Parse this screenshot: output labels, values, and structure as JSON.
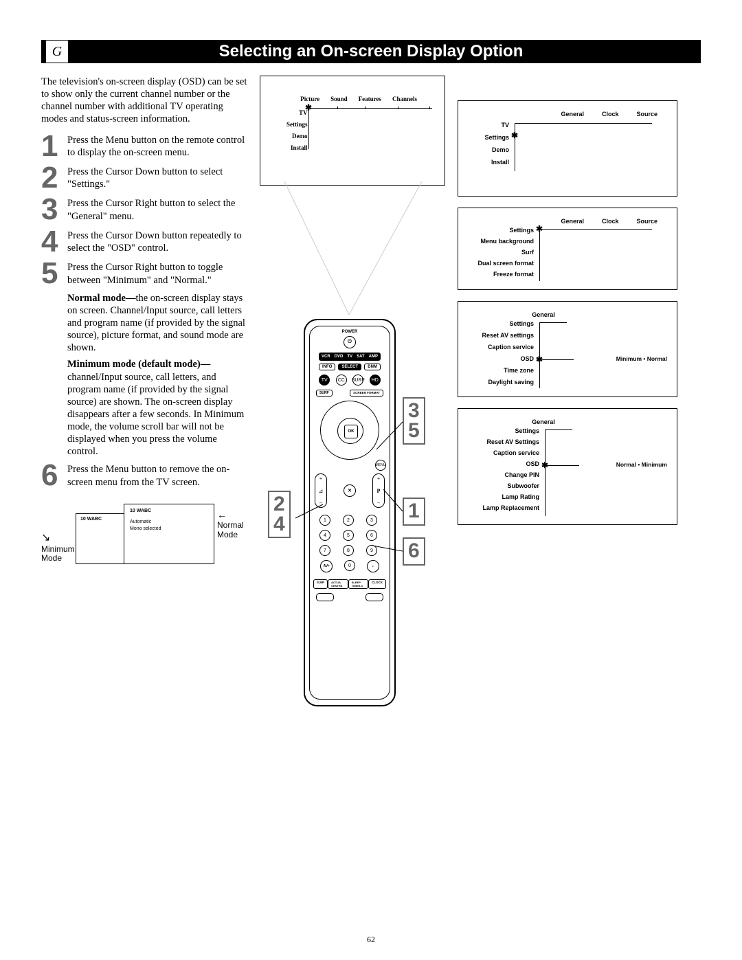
{
  "header": {
    "letter": "G",
    "title": "Selecting an On-screen Display Option"
  },
  "intro": "The television's on-screen display (OSD) can be set to show only the current channel number or the channel number with additional TV operating modes and status-screen information.",
  "steps": [
    {
      "n": "1",
      "text": "Press the Menu button on the remote control to display the on-screen menu."
    },
    {
      "n": "2",
      "text": "Press the Cursor Down button to select \"Settings.\""
    },
    {
      "n": "3",
      "text": "Press the Cursor Right button to select the \"General\" menu."
    },
    {
      "n": "4",
      "text": "Press the Cursor Down button repeatedly to select the \"OSD\" control."
    },
    {
      "n": "5",
      "text": "Press the Cursor Right button to toggle between \"Minimum\" and \"Normal.\""
    }
  ],
  "normal_mode_label": "Normal mode—",
  "normal_mode_text": "the on-screen display stays on screen. Channel/Input source, call letters and program name (if provided by the signal source), picture format, and sound mode are shown.",
  "minimum_mode_label": "Minimum mode (default mode)—",
  "minimum_mode_text": "channel/Input source, call letters, and program name (if provided by the signal source) are shown. The on-screen display disappears after a few seconds. In Minimum mode, the volume scroll bar will not be displayed when you press the volume control.",
  "step6": {
    "n": "6",
    "text": "Press the Menu button to remove the on-screen menu from the TV screen."
  },
  "top_menu": {
    "cols": [
      "Picture",
      "Sound",
      "Features",
      "Channels"
    ],
    "rows": [
      "TV",
      "Settings",
      "Demo",
      "Install"
    ]
  },
  "sidemenus": [
    {
      "cols": [
        "General",
        "Clock",
        "Source"
      ],
      "rows": [
        "TV",
        "Settings",
        "Demo",
        "Install"
      ]
    },
    {
      "cols": [
        "General",
        "Clock",
        "Source"
      ],
      "rows": [
        "Settings",
        "Menu background",
        "Surf",
        "Dual screen format",
        "Freeze format"
      ]
    },
    {
      "cols": [
        "General"
      ],
      "rows": [
        "Settings",
        "Reset AV settings",
        "Caption service",
        "OSD",
        "Time zone",
        "Daylight saving"
      ],
      "osd_options": "Minimum  •  Normal"
    },
    {
      "cols": [
        "General"
      ],
      "rows": [
        "Settings",
        "Reset AV Settings",
        "Caption service",
        "OSD",
        "Change PIN",
        "Subwoofer",
        "Lamp Rating",
        "Lamp Replacement"
      ],
      "osd_options": "Normal  •  Minimum"
    }
  ],
  "remote": {
    "power": "POWER",
    "sources": [
      "VCR",
      "DVD",
      "TV",
      "SAT",
      "AMP"
    ],
    "row1": [
      "INFO",
      "SELECT",
      "DNM"
    ],
    "row2": [
      "TV",
      "CC",
      "SURF",
      "HD"
    ],
    "row3": [
      "SURF",
      "",
      "",
      "SCREEN FORMAT"
    ],
    "ok": "OK",
    "menu": "MENU",
    "vol": "⊿",
    "mute": "✕",
    "prog": "P",
    "avplus": "AV+",
    "keypad": [
      "1",
      "2",
      "3",
      "4",
      "5",
      "6",
      "7",
      "8",
      "9",
      "0"
    ],
    "bottom": [
      "S.MP",
      "ACTUA CENTRE",
      "SLEEP TIMER-X",
      "CLOCK"
    ]
  },
  "callouts": {
    "c35": [
      "3",
      "5"
    ],
    "c24": [
      "2",
      "4"
    ],
    "c1": [
      "1"
    ],
    "c6": [
      "6"
    ]
  },
  "examples": {
    "channel": "10  WABC",
    "auto": "Automatic",
    "mono": "Mono selected",
    "min_label": "Minimum Mode",
    "norm_label": "Normal Mode"
  },
  "page_num": "62"
}
